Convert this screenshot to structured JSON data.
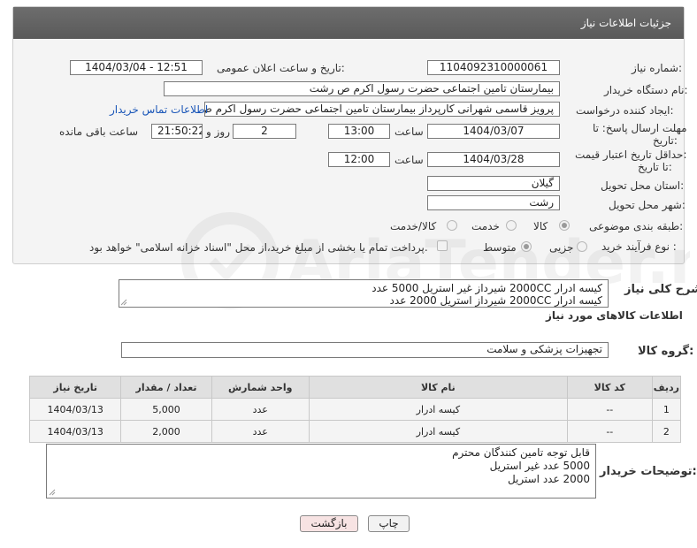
{
  "header": {
    "title": "جزئیات اطلاعات نیاز"
  },
  "form": {
    "need_number": {
      "label": "شماره نیاز:",
      "value": "1104092310000061"
    },
    "announce_datetime": {
      "label": "تاریخ و ساعت اعلان عمومی:",
      "value": "1404/03/04 - 12:51"
    },
    "buyer_org": {
      "label": "نام دستگاه خریدار:",
      "value": "بیمارستان  تامین اجتماعی حضرت رسول اکرم ص رشت"
    },
    "requester": {
      "label": "ایجاد کننده درخواست:",
      "value": "پرویز قاسمی شهرانی کارپرداز بیمارستان  تامین اجتماعی حضرت رسول اکرم ص",
      "contact_link": "اطلاعات تماس خریدار"
    },
    "reply_deadline": {
      "label_line1": "مهلت ارسال پاسخ: تا",
      "label_line2": "تاریخ:",
      "date": "1404/03/07",
      "time_label": "ساعت",
      "time": "13:00",
      "days": "2",
      "days_label": "روز و",
      "remaining": "21:50:22",
      "remaining_label": "ساعت باقی مانده"
    },
    "price_validity": {
      "label_line1": "حداقل تاریخ اعتبار قیمت:",
      "label_line2": "تا تاریخ:",
      "date": "1404/03/28",
      "time_label": "ساعت",
      "time": "12:00"
    },
    "province": {
      "label": "استان محل تحویل:",
      "value": "گیلان"
    },
    "city": {
      "label": "شهر محل تحویل:",
      "value": "رشت"
    },
    "category": {
      "label": "طبقه بندی موضوعی:",
      "options": [
        "کالا",
        "خدمت",
        "کالا/خدمت"
      ]
    },
    "purchase_type": {
      "label": "نوع فرآیند خرید :",
      "options": [
        "جزیی",
        "متوسط"
      ],
      "payment_note": "پرداخت تمام یا بخشی از مبلغ خرید،از محل \"اسناد خزانه اسلامی\" خواهد بود."
    }
  },
  "description": {
    "label": "شرح کلی نیاز:",
    "lines": [
      "کیسه ادرار 2000CC شیرداز غیر استریل  5000 عدد",
      "کیسه ادرار  2000CC شیرداز استریل 2000 عدد"
    ]
  },
  "goods_section": {
    "title": "اطلاعات کالاهای مورد نیاز",
    "group_label": "گروه کالا:",
    "group_value": "تجهیزات پزشکی و سلامت"
  },
  "table": {
    "columns": [
      "ردیف",
      "کد کالا",
      "نام کالا",
      "واحد شمارش",
      "تعداد / مقدار",
      "تاریخ نیاز"
    ],
    "rows": [
      [
        "1",
        "--",
        "کیسه ادرار",
        "عدد",
        "5,000",
        "1404/03/13"
      ],
      [
        "2",
        "--",
        "کیسه ادرار",
        "عدد",
        "2,000",
        "1404/03/13"
      ]
    ]
  },
  "buyer_notes": {
    "label": "توضیحات خریدار:",
    "lines": [
      "قابل توجه تامین کنندگان محترم",
      "5000 عدد غیر استریل",
      "2000 عدد استریل"
    ]
  },
  "buttons": {
    "print": "چاپ",
    "back": "بازگشت"
  },
  "watermark": {
    "text": "AriaTender.neT"
  },
  "colors": {
    "header_bg": "#5f5f5f",
    "frame_bg": "#f4f4f4",
    "link": "#1a56b8",
    "back_button_bg": "#f7e3e3"
  }
}
